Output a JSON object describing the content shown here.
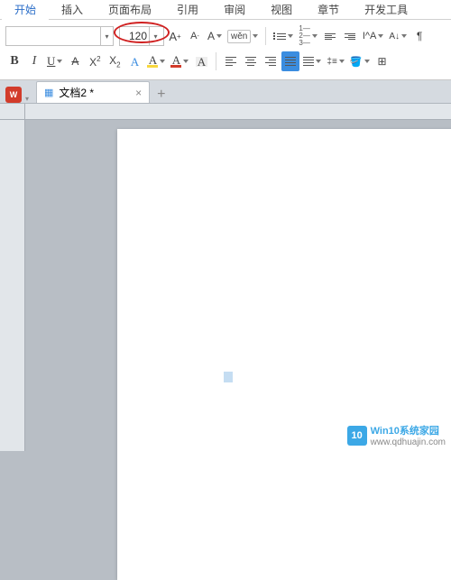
{
  "menu": {
    "tabs": [
      {
        "label": "开始",
        "active": true
      },
      {
        "label": "插入"
      },
      {
        "label": "页面布局"
      },
      {
        "label": "引用"
      },
      {
        "label": "审阅"
      },
      {
        "label": "视图"
      },
      {
        "label": "章节"
      },
      {
        "label": "开发工具"
      }
    ]
  },
  "toolbar": {
    "font_size": "120",
    "increase_a": "A⁺",
    "decrease_a": "A⁻",
    "clear_fmt": "A",
    "wen": "wěn",
    "bold": "B",
    "italic": "I",
    "underline": "U",
    "strike": "A",
    "sup": "X",
    "sub": "X",
    "font_a": "A",
    "highlight_a": "A",
    "font_color_a": "A",
    "char_shade_a": "A",
    "colors": {
      "highlight": "#f7d73e",
      "font": "#d23b2a",
      "shade": "#e9a23b"
    }
  },
  "doctabs": {
    "wps": "W",
    "doc_name": "文档2 *",
    "close": "×",
    "new": "+"
  },
  "watermark": {
    "logo": "10",
    "title": "Win10系统家园",
    "url": "www.qdhuajin.com"
  }
}
